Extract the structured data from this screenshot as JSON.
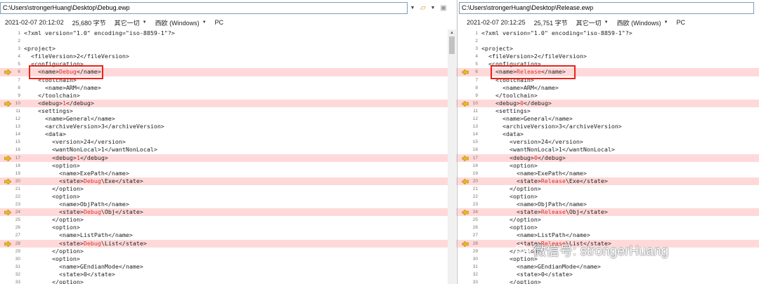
{
  "left": {
    "path": "C:\\Users\\strongerHuang\\Desktop\\Debug.ewp",
    "info": {
      "date": "2021-02-07 20:12:02",
      "size": "25,680 字节",
      "filter": "其它一切",
      "encoding": "西欧 (Windows)",
      "platform": "PC"
    },
    "lines": [
      {
        "n": "1",
        "t": "<?xml version=\"1.0\" encoding=\"iso-8859-1\"?>",
        "diff": false
      },
      {
        "n": "2",
        "t": "",
        "diff": false
      },
      {
        "n": "3",
        "t": "<project>",
        "diff": false
      },
      {
        "n": "4",
        "t": "  <fileVersion>2</fileVersion>",
        "diff": false
      },
      {
        "n": "5",
        "t": "  <configuration>",
        "diff": false
      },
      {
        "n": "6",
        "pre": "    <name>",
        "hl": "Debug",
        "post": "</name>",
        "diff": true
      },
      {
        "n": "7",
        "t": "    <toolchain>",
        "diff": false
      },
      {
        "n": "8",
        "t": "      <name>ARM</name>",
        "diff": false
      },
      {
        "n": "9",
        "t": "    </toolchain>",
        "diff": false
      },
      {
        "n": "10",
        "pre": "    <debug>",
        "hl": "1",
        "post": "</debug>",
        "diff": true
      },
      {
        "n": "11",
        "t": "    <settings>",
        "diff": false
      },
      {
        "n": "12",
        "t": "      <name>General</name>",
        "diff": false
      },
      {
        "n": "13",
        "t": "      <archiveVersion>3</archiveVersion>",
        "diff": false
      },
      {
        "n": "14",
        "t": "      <data>",
        "diff": false
      },
      {
        "n": "15",
        "t": "        <version>24</version>",
        "diff": false
      },
      {
        "n": "16",
        "t": "        <wantNonLocal>1</wantNonLocal>",
        "diff": false
      },
      {
        "n": "17",
        "pre": "        <debug>",
        "hl": "1",
        "post": "</debug>",
        "diff": true
      },
      {
        "n": "18",
        "t": "        <option>",
        "diff": false
      },
      {
        "n": "19",
        "t": "          <name>ExePath</name>",
        "diff": false
      },
      {
        "n": "20",
        "pre": "          <state>",
        "hl": "Debug",
        "post": "\\Exe</state>",
        "diff": true
      },
      {
        "n": "21",
        "t": "        </option>",
        "diff": false
      },
      {
        "n": "22",
        "t": "        <option>",
        "diff": false
      },
      {
        "n": "23",
        "t": "          <name>ObjPath</name>",
        "diff": false
      },
      {
        "n": "24",
        "pre": "          <state>",
        "hl": "Debug",
        "post": "\\Obj</state>",
        "diff": true
      },
      {
        "n": "25",
        "t": "        </option>",
        "diff": false
      },
      {
        "n": "26",
        "t": "        <option>",
        "diff": false
      },
      {
        "n": "27",
        "t": "          <name>ListPath</name>",
        "diff": false
      },
      {
        "n": "28",
        "pre": "          <state>",
        "hl": "Debug",
        "post": "\\List</state>",
        "diff": true
      },
      {
        "n": "29",
        "t": "        </option>",
        "diff": false
      },
      {
        "n": "30",
        "t": "        <option>",
        "diff": false
      },
      {
        "n": "31",
        "t": "          <name>GEndianMode</name>",
        "diff": false
      },
      {
        "n": "32",
        "t": "          <state>0</state>",
        "diff": false
      },
      {
        "n": "33",
        "t": "        </option>",
        "diff": false
      }
    ]
  },
  "right": {
    "path": "C:\\Users\\strongerHuang\\Desktop\\Release.ewp",
    "info": {
      "date": "2021-02-07 20:12:25",
      "size": "25,751 字节",
      "filter": "其它一切",
      "encoding": "西欧 (Windows)",
      "platform": "PC"
    },
    "lines": [
      {
        "n": "1",
        "t": "<?xml version=\"1.0\" encoding=\"iso-8859-1\"?>",
        "diff": false
      },
      {
        "n": "2",
        "t": "",
        "diff": false
      },
      {
        "n": "3",
        "t": "<project>",
        "diff": false
      },
      {
        "n": "4",
        "t": "  <fileVersion>2</fileVersion>",
        "diff": false
      },
      {
        "n": "5",
        "t": "  <configuration>",
        "diff": false
      },
      {
        "n": "6",
        "pre": "    <name>",
        "hl": "Release",
        "post": "</name>",
        "diff": true
      },
      {
        "n": "7",
        "t": "    <toolchain>",
        "diff": false
      },
      {
        "n": "8",
        "t": "      <name>ARM</name>",
        "diff": false
      },
      {
        "n": "9",
        "t": "    </toolchain>",
        "diff": false
      },
      {
        "n": "10",
        "pre": "    <debug>",
        "hl": "0",
        "post": "</debug>",
        "diff": true
      },
      {
        "n": "11",
        "t": "    <settings>",
        "diff": false
      },
      {
        "n": "12",
        "t": "      <name>General</name>",
        "diff": false
      },
      {
        "n": "13",
        "t": "      <archiveVersion>3</archiveVersion>",
        "diff": false
      },
      {
        "n": "14",
        "t": "      <data>",
        "diff": false
      },
      {
        "n": "15",
        "t": "        <version>24</version>",
        "diff": false
      },
      {
        "n": "16",
        "t": "        <wantNonLocal>1</wantNonLocal>",
        "diff": false
      },
      {
        "n": "17",
        "pre": "        <debug>",
        "hl": "0",
        "post": "</debug>",
        "diff": true
      },
      {
        "n": "18",
        "t": "        <option>",
        "diff": false
      },
      {
        "n": "19",
        "t": "          <name>ExePath</name>",
        "diff": false
      },
      {
        "n": "20",
        "pre": "          <state>",
        "hl": "Release",
        "post": "\\Exe</state>",
        "diff": true
      },
      {
        "n": "21",
        "t": "        </option>",
        "diff": false
      },
      {
        "n": "22",
        "t": "        <option>",
        "diff": false
      },
      {
        "n": "23",
        "t": "          <name>ObjPath</name>",
        "diff": false
      },
      {
        "n": "24",
        "pre": "          <state>",
        "hl": "Release",
        "post": "\\Obj</state>",
        "diff": true
      },
      {
        "n": "25",
        "t": "        </option>",
        "diff": false
      },
      {
        "n": "26",
        "t": "        <option>",
        "diff": false
      },
      {
        "n": "27",
        "t": "          <name>ListPath</name>",
        "diff": false
      },
      {
        "n": "28",
        "pre": "          <state>",
        "hl": "Release",
        "post": "\\List</state>",
        "diff": true
      },
      {
        "n": "29",
        "t": "        </option>",
        "diff": false
      },
      {
        "n": "30",
        "t": "        <option>",
        "diff": false
      },
      {
        "n": "31",
        "t": "          <name>GEndianMode</name>",
        "diff": false
      },
      {
        "n": "32",
        "t": "          <state>0</state>",
        "diff": false
      },
      {
        "n": "33",
        "t": "        </option>",
        "diff": false
      }
    ]
  },
  "watermark": "微信号: strongerHuang",
  "colors": {
    "diff_bg": "#ffd9d9",
    "highlight": "#d9302c",
    "marker": "#e0b020",
    "box": "#e8231c"
  }
}
